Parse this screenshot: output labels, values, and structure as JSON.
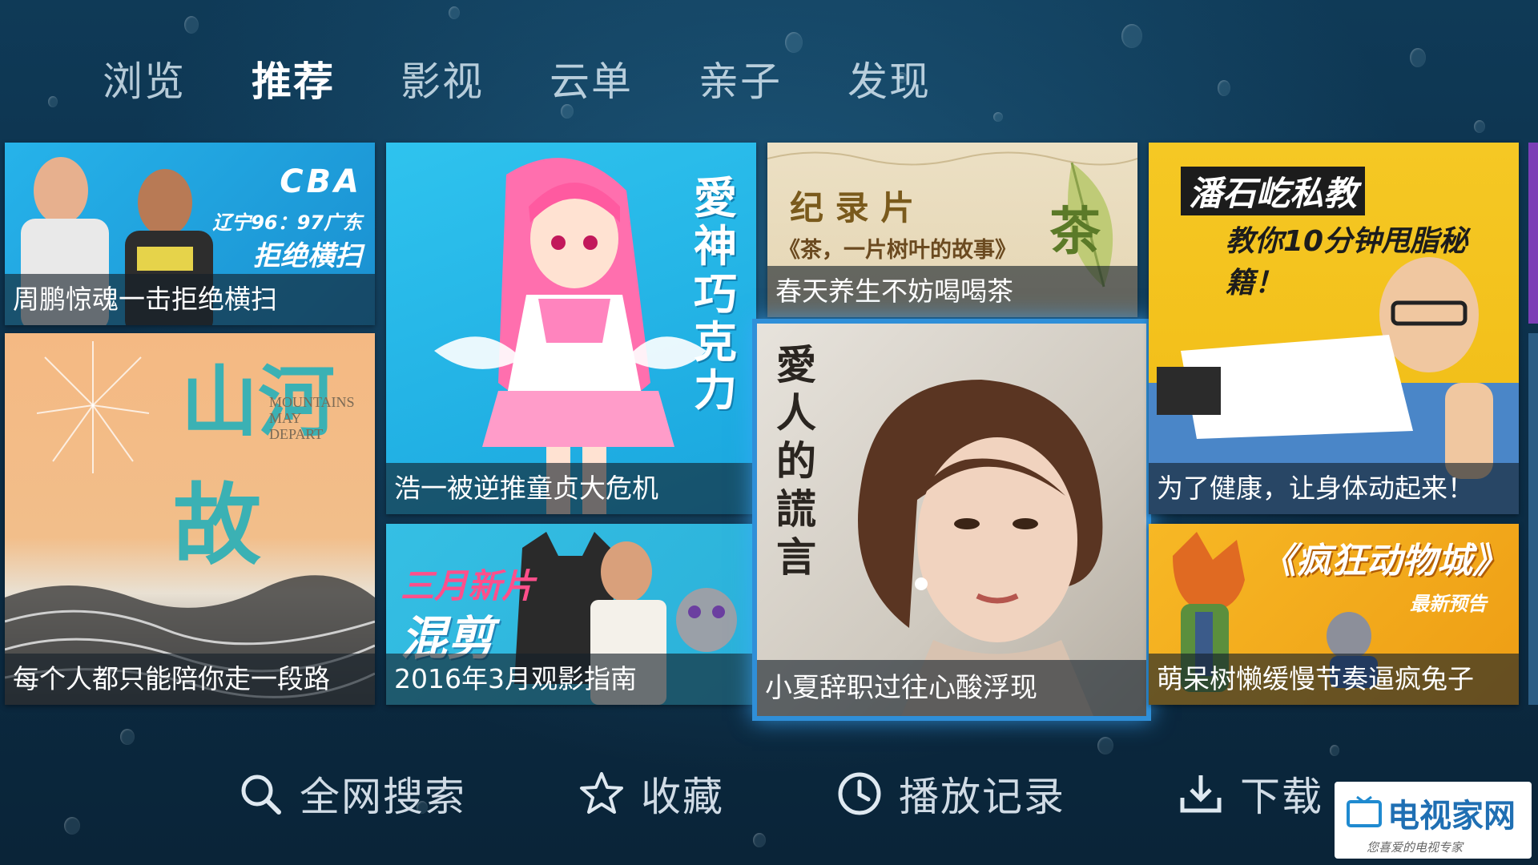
{
  "nav": {
    "tabs": [
      {
        "label": "浏览"
      },
      {
        "label": "推荐"
      },
      {
        "label": "影视"
      },
      {
        "label": "云单"
      },
      {
        "label": "亲子"
      },
      {
        "label": "发现"
      }
    ],
    "active_tab": "推荐"
  },
  "tiles": {
    "cba": {
      "caption": "周鹏惊魂一击拒绝横扫",
      "overlay": [
        "CBA",
        "辽宁96：97广东",
        "拒绝横扫"
      ]
    },
    "mountains": {
      "caption": "每个人都只能陪你走一段路",
      "overlay": [
        "山河",
        "故",
        "MOUNTAINS",
        "MAY",
        "DEPART"
      ]
    },
    "anime": {
      "caption": "浩一被逆推童贞大危机",
      "overlay": [
        "愛神巧克力"
      ]
    },
    "march": {
      "caption": "2016年3月观影指南",
      "overlay": [
        "三月新片",
        "混剪"
      ]
    },
    "tea": {
      "caption": "春天养生不妨喝喝茶",
      "overlay": [
        "纪 录 片",
        "《茶，一片树叶的故事》",
        "茶"
      ]
    },
    "drama": {
      "caption": "小夏辞职过往心酸浮现",
      "overlay": [
        "愛人的謊言"
      ]
    },
    "fitness": {
      "caption": "为了健康，让身体动起来！",
      "overlay": [
        "潘石屹私教",
        "教你10分钟甩脂秘籍！"
      ]
    },
    "zootopia": {
      "caption": "萌呆树懒缓慢节奏逼疯兔子",
      "overlay": [
        "《疯狂动物城》",
        "最新预告"
      ]
    }
  },
  "bottom": {
    "search": "全网搜索",
    "favorites": "收藏",
    "history": "播放记录",
    "download": "下载"
  },
  "watermark": {
    "title": "电视家网",
    "subtitle": "您喜爱的电视专家"
  },
  "colors": {
    "focus": "#2f8fd8",
    "cba_bg": "#1fa3e0",
    "anime_bg": "#26b6e6",
    "fitness_bg": "#f2c21a",
    "zootopia_bg": "#f0a81c"
  }
}
